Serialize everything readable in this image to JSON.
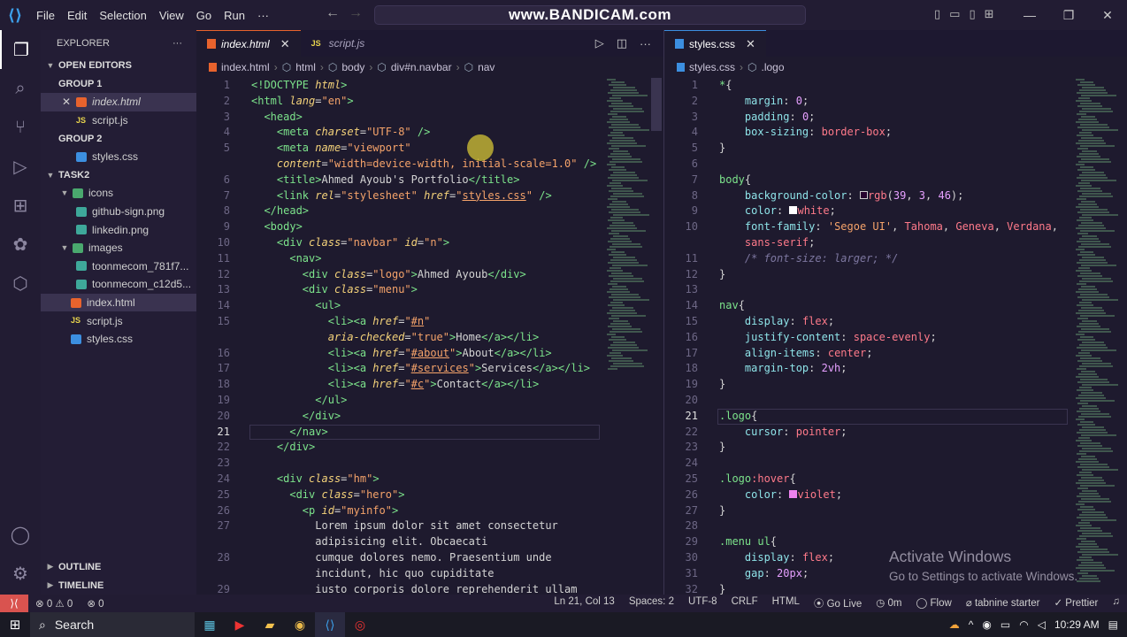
{
  "titlebar": {
    "menu": [
      "File",
      "Edit",
      "Selection",
      "View",
      "Go",
      "Run",
      "···"
    ],
    "search_text": "www.BANDICAM.com"
  },
  "explorer": {
    "title": "EXPLORER",
    "more": "···",
    "open_editors": "OPEN EDITORS",
    "group1": "GROUP 1",
    "group1_files": [
      "index.html",
      "script.js"
    ],
    "group2": "GROUP 2",
    "group2_files": [
      "styles.css"
    ],
    "folder": "TASK2",
    "tree": [
      {
        "label": "icons",
        "type": "folder",
        "depth": 1
      },
      {
        "label": "github-sign.png",
        "type": "img",
        "depth": 2
      },
      {
        "label": "linkedin.png",
        "type": "img",
        "depth": 2
      },
      {
        "label": "images",
        "type": "folder",
        "depth": 1
      },
      {
        "label": "toonmecom_781f7...",
        "type": "img",
        "depth": 2
      },
      {
        "label": "toonmecom_c12d5...",
        "type": "img",
        "depth": 2
      },
      {
        "label": "index.html",
        "type": "html",
        "depth": 1
      },
      {
        "label": "script.js",
        "type": "js",
        "depth": 1
      },
      {
        "label": "styles.css",
        "type": "css",
        "depth": 1
      }
    ],
    "outline": "OUTLINE",
    "timeline": "TIMELINE"
  },
  "left_editor": {
    "tabs": [
      {
        "label": "index.html",
        "active": true
      },
      {
        "label": "script.js",
        "active": false
      }
    ],
    "breadcrumb": [
      "index.html",
      "html",
      "body",
      "div#n.navbar",
      "nav"
    ],
    "lines": [
      {
        "n": "1",
        "h": "<span class='t-tag'>&lt;!DOCTYPE</span> <span class='t-attr'>html</span><span class='t-tag'>&gt;</span>"
      },
      {
        "n": "2",
        "h": "<span class='t-tag'>&lt;html</span> <span class='t-attr'>lang</span>=<span class='t-str'>\"en\"</span><span class='t-tag'>&gt;</span>"
      },
      {
        "n": "3",
        "h": "  <span class='t-tag'>&lt;head&gt;</span>"
      },
      {
        "n": "4",
        "h": "    <span class='t-tag'>&lt;meta</span> <span class='t-attr'>charset</span>=<span class='t-str'>\"UTF-8\"</span> <span class='t-tag'>/&gt;</span>"
      },
      {
        "n": "5",
        "h": "    <span class='t-tag'>&lt;meta</span> <span class='t-attr'>name</span>=<span class='t-str'>\"viewport\"</span>"
      },
      {
        "n": "",
        "h": "    <span class='t-attr'>content</span>=<span class='t-str'>\"width=device-width, initial-scale=1.0\"</span> <span class='t-tag'>/&gt;</span>"
      },
      {
        "n": "6",
        "h": "    <span class='t-tag'>&lt;title&gt;</span>Ahmed Ayoub's Portfolio<span class='t-tag'>&lt;/title&gt;</span>"
      },
      {
        "n": "7",
        "h": "    <span class='t-tag'>&lt;link</span> <span class='t-attr'>rel</span>=<span class='t-str'>\"stylesheet\"</span> <span class='t-attr'>href</span>=<span class='t-str'>\"<u>styles.css</u>\"</span> <span class='t-tag'>/&gt;</span>"
      },
      {
        "n": "8",
        "h": "  <span class='t-tag'>&lt;/head&gt;</span>"
      },
      {
        "n": "9",
        "h": "  <span class='t-tag'>&lt;body&gt;</span>"
      },
      {
        "n": "10",
        "h": "    <span class='t-tag'>&lt;div</span> <span class='t-attr'>class</span>=<span class='t-str'>\"navbar\"</span> <span class='t-attr'>id</span>=<span class='t-str'>\"n\"</span><span class='t-tag'>&gt;</span>"
      },
      {
        "n": "11",
        "h": "      <span class='t-tag'>&lt;nav&gt;</span>"
      },
      {
        "n": "12",
        "h": "        <span class='t-tag'>&lt;div</span> <span class='t-attr'>class</span>=<span class='t-str'>\"logo\"</span><span class='t-tag'>&gt;</span>Ahmed Ayoub<span class='t-tag'>&lt;/div&gt;</span>"
      },
      {
        "n": "13",
        "h": "        <span class='t-tag'>&lt;div</span> <span class='t-attr'>class</span>=<span class='t-str'>\"menu\"</span><span class='t-tag'>&gt;</span>"
      },
      {
        "n": "14",
        "h": "          <span class='t-tag'>&lt;ul&gt;</span>"
      },
      {
        "n": "15",
        "h": "            <span class='t-tag'>&lt;li&gt;&lt;a</span> <span class='t-attr'>href</span>=<span class='t-str'>\"<u>#n</u>\"</span>"
      },
      {
        "n": "",
        "h": "            <span class='t-attr'>aria-checked</span>=<span class='t-str'>\"true\"</span><span class='t-tag'>&gt;</span>Home<span class='t-tag'>&lt;/a&gt;&lt;/li&gt;</span>"
      },
      {
        "n": "16",
        "h": "            <span class='t-tag'>&lt;li&gt;&lt;a</span> <span class='t-attr'>href</span>=<span class='t-str'>\"<u>#about</u>\"</span><span class='t-tag'>&gt;</span>About<span class='t-tag'>&lt;/a&gt;&lt;/li&gt;</span>"
      },
      {
        "n": "17",
        "h": "            <span class='t-tag'>&lt;li&gt;&lt;a</span> <span class='t-attr'>href</span>=<span class='t-str'>\"<u>#services</u>\"</span><span class='t-tag'>&gt;</span>Services<span class='t-tag'>&lt;/a&gt;&lt;/li&gt;</span>"
      },
      {
        "n": "18",
        "h": "            <span class='t-tag'>&lt;li&gt;&lt;a</span> <span class='t-attr'>href</span>=<span class='t-str'>\"<u>#c</u>\"</span><span class='t-tag'>&gt;</span>Contact<span class='t-tag'>&lt;/a&gt;&lt;/li&gt;</span>"
      },
      {
        "n": "19",
        "h": "          <span class='t-tag'>&lt;/ul&gt;</span>"
      },
      {
        "n": "20",
        "h": "        <span class='t-tag'>&lt;/div&gt;</span>"
      },
      {
        "n": "21",
        "h": "      <span class='t-tag'>&lt;/nav&gt;</span>",
        "cur": true
      },
      {
        "n": "22",
        "h": "    <span class='t-tag'>&lt;/div&gt;</span>"
      },
      {
        "n": "23",
        "h": ""
      },
      {
        "n": "24",
        "h": "    <span class='t-tag'>&lt;div</span> <span class='t-attr'>class</span>=<span class='t-str'>\"hm\"</span><span class='t-tag'>&gt;</span>"
      },
      {
        "n": "25",
        "h": "      <span class='t-tag'>&lt;div</span> <span class='t-attr'>class</span>=<span class='t-str'>\"hero\"</span><span class='t-tag'>&gt;</span>"
      },
      {
        "n": "26",
        "h": "        <span class='t-tag'>&lt;p</span> <span class='t-attr'>id</span>=<span class='t-str'>\"myinfo\"</span><span class='t-tag'>&gt;</span>"
      },
      {
        "n": "27",
        "h": "          Lorem ipsum dolor sit amet consectetur"
      },
      {
        "n": "",
        "h": "          adipisicing elit. Obcaecati"
      },
      {
        "n": "28",
        "h": "          cumque dolores nemo. Praesentium unde"
      },
      {
        "n": "",
        "h": "          incidunt, hic quo cupiditate"
      },
      {
        "n": "29",
        "h": "          iusto corporis dolore reprehenderit ullam"
      }
    ]
  },
  "right_editor": {
    "tabs": [
      {
        "label": "styles.css",
        "active": true
      }
    ],
    "breadcrumb": [
      "styles.css",
      ".logo"
    ],
    "lines": [
      {
        "n": "1",
        "h": "<span class='t-sel'>*</span>{"
      },
      {
        "n": "2",
        "h": "    <span class='t-prop'>margin</span>: <span class='t-num'>0</span>;"
      },
      {
        "n": "3",
        "h": "    <span class='t-prop'>padding</span>: <span class='t-num'>0</span>;"
      },
      {
        "n": "4",
        "h": "    <span class='t-prop'>box-sizing</span>: <span class='t-val'>border-box</span>;"
      },
      {
        "n": "5",
        "h": "}"
      },
      {
        "n": "6",
        "h": ""
      },
      {
        "n": "7",
        "h": "<span class='t-sel'>body</span>{"
      },
      {
        "n": "8",
        "h": "    <span class='t-prop'>background-color</span>: <span style='display:inline-block;width:9px;height:9px;border:1px solid #ccc;background:#27032e'></span><span class='t-val'>rgb</span>(<span class='t-num'>39</span>, <span class='t-num'>3</span>, <span class='t-num'>46</span>);"
      },
      {
        "n": "9",
        "h": "    <span class='t-prop'>color</span>: <span style='display:inline-block;width:9px;height:9px;background:#fff'></span><span class='t-val'>white</span>;"
      },
      {
        "n": "10",
        "h": "    <span class='t-prop'>font-family</span>: <span class='t-str'>'Segoe UI'</span>, <span class='t-val'>Tahoma</span>, <span class='t-val'>Geneva</span>, <span class='t-val'>Verdana</span>,"
      },
      {
        "n": "",
        "h": "    <span class='t-val'>sans-serif</span>;"
      },
      {
        "n": "11",
        "h": "    <span class='t-com'>/* font-size: larger; */</span>"
      },
      {
        "n": "12",
        "h": "}"
      },
      {
        "n": "13",
        "h": ""
      },
      {
        "n": "14",
        "h": "<span class='t-sel'>nav</span>{"
      },
      {
        "n": "15",
        "h": "    <span class='t-prop'>display</span>: <span class='t-val'>flex</span>;"
      },
      {
        "n": "16",
        "h": "    <span class='t-prop'>justify-content</span>: <span class='t-val'>space-evenly</span>;"
      },
      {
        "n": "17",
        "h": "    <span class='t-prop'>align-items</span>: <span class='t-val'>center</span>;"
      },
      {
        "n": "18",
        "h": "    <span class='t-prop'>margin-top</span>: <span class='t-num'>2vh</span>;"
      },
      {
        "n": "19",
        "h": "}"
      },
      {
        "n": "20",
        "h": ""
      },
      {
        "n": "21",
        "h": "<span class='t-sel'>.logo</span>{",
        "cur": true
      },
      {
        "n": "22",
        "h": "    <span class='t-prop'>cursor</span>: <span class='t-val'>pointer</span>;"
      },
      {
        "n": "23",
        "h": "}"
      },
      {
        "n": "24",
        "h": ""
      },
      {
        "n": "25",
        "h": "<span class='t-sel'>.logo</span><span class='t-val'>:hover</span>{"
      },
      {
        "n": "26",
        "h": "    <span class='t-prop'>color</span>: <span style='display:inline-block;width:9px;height:9px;background:#ee82ee'></span><span class='t-val'>violet</span>;"
      },
      {
        "n": "27",
        "h": "}"
      },
      {
        "n": "28",
        "h": ""
      },
      {
        "n": "29",
        "h": "<span class='t-sel'>.menu ul</span>{"
      },
      {
        "n": "30",
        "h": "    <span class='t-prop'>display</span>: <span class='t-val'>flex</span>;"
      },
      {
        "n": "31",
        "h": "    <span class='t-prop'>gap</span>: <span class='t-num'>20px</span>;"
      },
      {
        "n": "32",
        "h": "}"
      }
    ]
  },
  "watermark": {
    "line1": "Activate Windows",
    "line2": "Go to Settings to activate Windows."
  },
  "statusbar": {
    "remote_icon": "remote-icon",
    "problems": "⊗ 0 ⚠ 0",
    "ports": "⊗ 0",
    "right": [
      "Ln 21, Col 13",
      "Spaces: 2",
      "UTF-8",
      "CRLF",
      "HTML",
      "⦿ Go Live",
      "◷ 0m",
      "◯ Flow",
      "⌀ tabnine starter",
      "✓ Prettier"
    ]
  },
  "taskbar": {
    "search": "Search",
    "time": "10:29 AM"
  },
  "colors": {
    "accent": "#e8632d",
    "bg": "#1e1a2e"
  }
}
